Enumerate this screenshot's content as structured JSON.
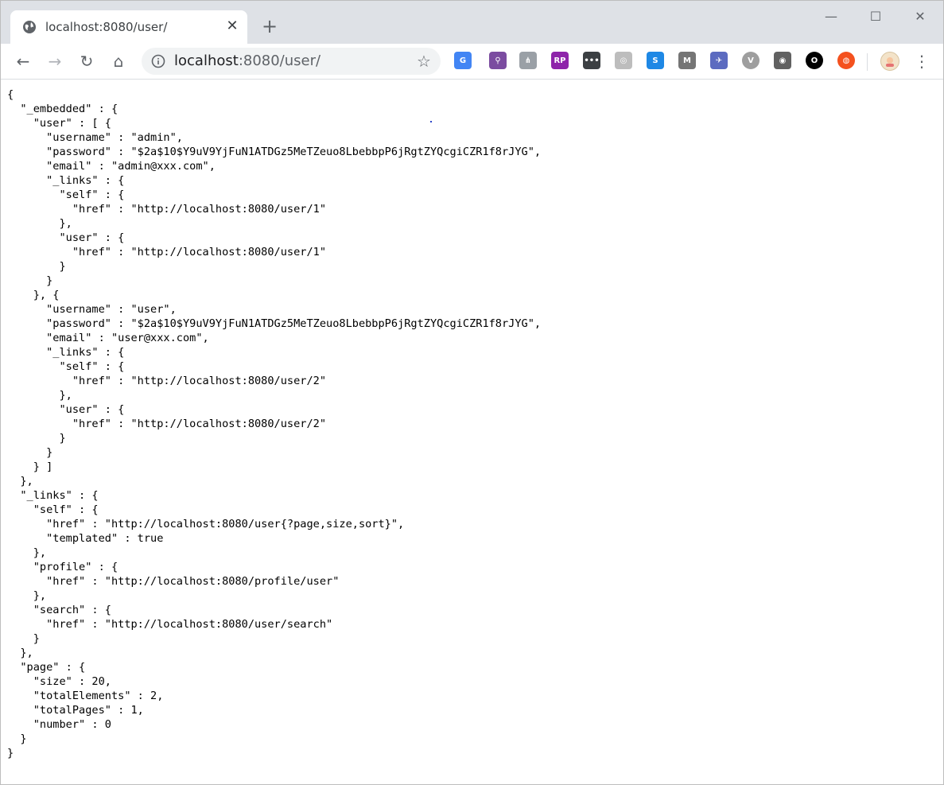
{
  "browser": {
    "tab": {
      "title": "localhost:8080/user/",
      "close_glyph": "✕",
      "icon": "globe-icon"
    },
    "new_tab_glyph": "+",
    "window_controls": {
      "minimize": "—",
      "maximize": "☐",
      "close": "✕"
    },
    "nav": {
      "back": "←",
      "forward": "→",
      "reload": "↻",
      "home": "⌂"
    },
    "address": {
      "host": "localhost",
      "rest": ":8080/user/"
    },
    "bookmark_glyph": "☆",
    "menu_glyph": "⋮",
    "extensions": [
      {
        "name": "google-translate-extension-icon",
        "label": "G",
        "color": "#4285f4"
      },
      {
        "name": "color-picker-extension-icon",
        "label": "⚲",
        "color": "#7b4ca0"
      },
      {
        "name": "sitemap-extension-icon",
        "label": "⋔",
        "color": "#9aa0a6"
      },
      {
        "name": "axure-rp-extension-icon",
        "label": "RP",
        "color": "#8e24aa"
      },
      {
        "name": "dots-extension-icon",
        "label": "•••",
        "color": "#3c4043"
      },
      {
        "name": "target-extension-icon",
        "label": "◎",
        "color": "#bdbdbd"
      },
      {
        "name": "s-extension-icon",
        "label": "S",
        "color": "#1e88e5"
      },
      {
        "name": "gmail-checker-extension-icon",
        "label": "M",
        "color": "#757575"
      },
      {
        "name": "bird-extension-icon",
        "label": "✈",
        "color": "#5c6bc0"
      },
      {
        "name": "vue-devtools-extension-icon",
        "label": "V",
        "color": "#9e9e9e"
      },
      {
        "name": "eye-extension-icon",
        "label": "◉",
        "color": "#616161"
      },
      {
        "name": "circle-extension-icon",
        "label": "O",
        "color": "#000000"
      },
      {
        "name": "lifebuoy-extension-icon",
        "label": "◍",
        "color": "#f4511e"
      }
    ],
    "profile_icon": "avatar"
  },
  "json_text": "{\n  \"_embedded\" : {\n    \"user\" : [ {\n      \"username\" : \"admin\",\n      \"password\" : \"$2a$10$Y9uV9YjFuN1ATDGz5MeTZeuo8LbebbpP6jRgtZYQcgiCZR1f8rJYG\",\n      \"email\" : \"admin@xxx.com\",\n      \"_links\" : {\n        \"self\" : {\n          \"href\" : \"http://localhost:8080/user/1\"\n        },\n        \"user\" : {\n          \"href\" : \"http://localhost:8080/user/1\"\n        }\n      }\n    }, {\n      \"username\" : \"user\",\n      \"password\" : \"$2a$10$Y9uV9YjFuN1ATDGz5MeTZeuo8LbebbpP6jRgtZYQcgiCZR1f8rJYG\",\n      \"email\" : \"user@xxx.com\",\n      \"_links\" : {\n        \"self\" : {\n          \"href\" : \"http://localhost:8080/user/2\"\n        },\n        \"user\" : {\n          \"href\" : \"http://localhost:8080/user/2\"\n        }\n      }\n    } ]\n  },\n  \"_links\" : {\n    \"self\" : {\n      \"href\" : \"http://localhost:8080/user{?page,size,sort}\",\n      \"templated\" : true\n    },\n    \"profile\" : {\n      \"href\" : \"http://localhost:8080/profile/user\"\n    },\n    \"search\" : {\n      \"href\" : \"http://localhost:8080/user/search\"\n    }\n  },\n  \"page\" : {\n    \"size\" : 20,\n    \"totalElements\" : 2,\n    \"totalPages\" : 1,\n    \"number\" : 0\n  }\n}"
}
